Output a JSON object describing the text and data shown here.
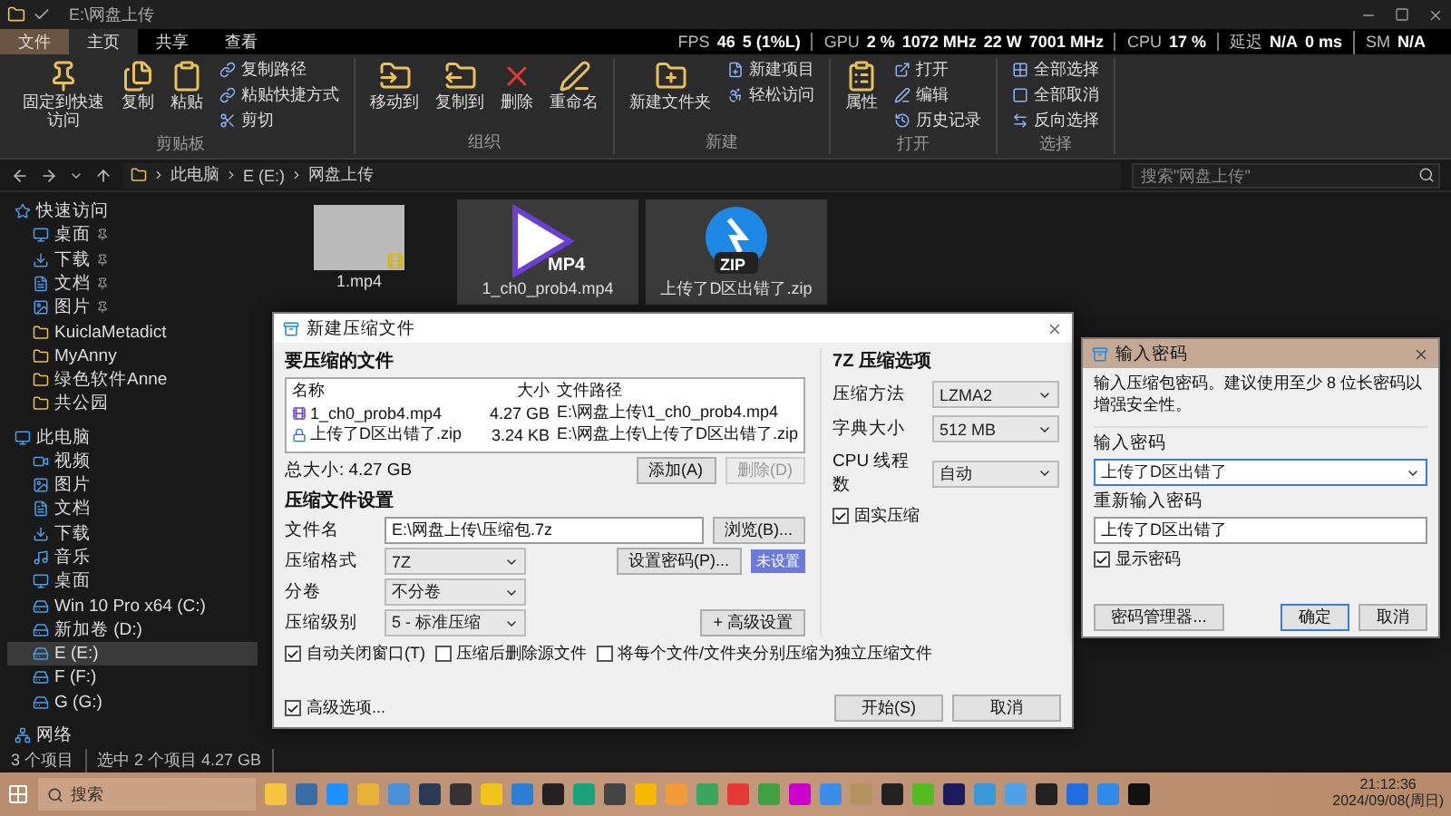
{
  "window": {
    "title": "E:\\网盘上传"
  },
  "overlay": [
    {
      "label": "FPS",
      "values": [
        "46",
        "5 (1%L)"
      ]
    },
    {
      "label": "GPU",
      "values": [
        "2 %",
        "1072 MHz",
        "22 W",
        "7001 MHz"
      ]
    },
    {
      "label": "CPU",
      "values": [
        "17 %"
      ]
    },
    {
      "label": "延迟",
      "values": [
        "N/A",
        "0 ms"
      ]
    },
    {
      "label": "SM",
      "values": [
        "N/A"
      ]
    }
  ],
  "ribbon": {
    "tabs": [
      {
        "label": "文件",
        "selected": false
      },
      {
        "label": "主页",
        "selected": true
      },
      {
        "label": "共享",
        "selected": false
      },
      {
        "label": "查看",
        "selected": false
      }
    ],
    "groups": [
      {
        "label": "剪贴板",
        "items": [
          {
            "label": "固定到快速访问",
            "kind": "large"
          },
          {
            "label": "复制",
            "kind": "large"
          },
          {
            "label": "粘贴",
            "kind": "large"
          },
          {
            "label": "复制路径",
            "kind": "small"
          },
          {
            "label": "粘贴快捷方式",
            "kind": "small"
          },
          {
            "label": "剪切",
            "kind": "small"
          }
        ]
      },
      {
        "label": "组织",
        "items": [
          {
            "label": "移动到",
            "kind": "large"
          },
          {
            "label": "复制到",
            "kind": "large"
          },
          {
            "label": "删除",
            "kind": "large"
          },
          {
            "label": "重命名",
            "kind": "large"
          }
        ]
      },
      {
        "label": "新建",
        "items": [
          {
            "label": "新建文件夹",
            "kind": "large"
          },
          {
            "label": "新建项目",
            "kind": "small"
          },
          {
            "label": "轻松访问",
            "kind": "small"
          }
        ]
      },
      {
        "label": "打开",
        "items": [
          {
            "label": "属性",
            "kind": "large"
          },
          {
            "label": "打开",
            "kind": "small"
          },
          {
            "label": "编辑",
            "kind": "small"
          },
          {
            "label": "历史记录",
            "kind": "small"
          }
        ]
      },
      {
        "label": "选择",
        "items": [
          {
            "label": "全部选择",
            "kind": "small"
          },
          {
            "label": "全部取消",
            "kind": "small"
          },
          {
            "label": "反向选择",
            "kind": "small"
          }
        ]
      }
    ]
  },
  "address": {
    "crumbs": [
      "此电脑",
      "E (E:)",
      "网盘上传"
    ],
    "search_placeholder": "搜索\"网盘上传\""
  },
  "sidebar": {
    "items": [
      {
        "label": "快速访问",
        "kind": "star",
        "selected": false,
        "children": [
          {
            "label": "桌面",
            "kind": "desktop",
            "selected": false,
            "pinned": true
          },
          {
            "label": "下载",
            "kind": "download",
            "selected": false,
            "pinned": true
          },
          {
            "label": "文档",
            "kind": "document",
            "selected": false,
            "pinned": true
          },
          {
            "label": "图片",
            "kind": "picture",
            "selected": false,
            "pinned": true
          },
          {
            "label": "KuiclaMetadict",
            "kind": "folder",
            "selected": false,
            "pinned": false
          },
          {
            "label": "MyAnny",
            "kind": "folder",
            "selected": false,
            "pinned": false
          },
          {
            "label": "绿色软件Anne",
            "kind": "folder",
            "selected": false,
            "pinned": false
          },
          {
            "label": "共公园",
            "kind": "folder",
            "selected": false,
            "pinned": false
          }
        ]
      },
      {
        "label": "此电脑",
        "kind": "pc",
        "selected": false,
        "children": [
          {
            "label": "视频",
            "kind": "video",
            "selected": false
          },
          {
            "label": "图片",
            "kind": "picture",
            "selected": false
          },
          {
            "label": "文档",
            "kind": "document",
            "selected": false
          },
          {
            "label": "下载",
            "kind": "download",
            "selected": false
          },
          {
            "label": "音乐",
            "kind": "music",
            "selected": false
          },
          {
            "label": "桌面",
            "kind": "desktop",
            "selected": false
          },
          {
            "label": "Win 10 Pro x64 (C:)",
            "kind": "drive",
            "selected": false
          },
          {
            "label": "新加卷 (D:)",
            "kind": "drive",
            "selected": false
          },
          {
            "label": "E (E:)",
            "kind": "drive",
            "selected": true
          },
          {
            "label": "F (F:)",
            "kind": "drive",
            "selected": false
          },
          {
            "label": "G (G:)",
            "kind": "drive",
            "selected": false
          }
        ]
      },
      {
        "label": "网络",
        "kind": "network",
        "selected": false
      }
    ]
  },
  "files": [
    {
      "name": "1.mp4",
      "kind": "video",
      "selected": false
    },
    {
      "name": "1_ch0_prob4.mp4",
      "kind": "mp4",
      "badge": "MP4",
      "selected": true
    },
    {
      "name": "上传了D区出错了.zip",
      "kind": "zip",
      "badge": "ZIP",
      "selected": true
    }
  ],
  "archive_dialog": {
    "title": "新建压缩文件",
    "files_header": "要压缩的文件",
    "columns": [
      "名称",
      "大小",
      "文件路径"
    ],
    "rows": [
      {
        "cells": [
          "1_ch0_prob4.mp4",
          "4.27 GB",
          "E:\\网盘上传\\1_ch0_prob4.mp4"
        ],
        "kind": "video"
      },
      {
        "cells": [
          "上传了D区出错了.zip",
          "3.24 KB",
          "E:\\网盘上传\\上传了D区出错了.zip"
        ],
        "kind": "zip"
      }
    ],
    "total": "总大小: 4.27 GB",
    "list_buttons": [
      {
        "label": "添加(A)",
        "disabled": false
      },
      {
        "label": "删除(D)",
        "disabled": true
      }
    ],
    "settings_header": "压缩文件设置",
    "fields": [
      {
        "label": "文件名",
        "kind": "input",
        "value": "E:\\网盘上传\\压缩包.7z",
        "button": "浏览(B)..."
      },
      {
        "label": "压缩格式",
        "kind": "select",
        "value": "7Z",
        "button": "设置密码(P)...",
        "tag": "未设置"
      },
      {
        "label": "分卷",
        "kind": "select",
        "value": "不分卷"
      },
      {
        "label": "压缩级别",
        "kind": "select",
        "value": "5 - 标准压缩",
        "button": "+ 高级设置"
      }
    ],
    "checks": [
      {
        "label": "自动关闭窗口(T)",
        "checked": true
      },
      {
        "label": "压缩后删除源文件",
        "checked": false
      },
      {
        "label": "将每个文件/文件夹分别压缩为独立压缩文件",
        "checked": false
      }
    ],
    "options_header": "7Z 压缩选项",
    "options": [
      {
        "label": "压缩方法",
        "value": "LZMA2"
      },
      {
        "label": "字典大小",
        "value": "512 MB"
      },
      {
        "label": "CPU 线程数",
        "value": "自动"
      }
    ],
    "solid": {
      "label": "固实压缩",
      "checked": true
    },
    "advanced": {
      "label": "高级选项...",
      "checked": true
    },
    "buttons": [
      "开始(S)",
      "取消"
    ]
  },
  "password_dialog": {
    "title": "输入密码",
    "message": "输入压缩包密码。建议使用至少 8 位长密码以增强安全性。",
    "fields": [
      {
        "label": "输入密码",
        "value": "上传了D区出错了",
        "kind": "select"
      },
      {
        "label": "重新输入密码",
        "value": "上传了D区出错了",
        "kind": "input"
      }
    ],
    "show": {
      "label": "显示密码",
      "checked": true
    },
    "buttons": [
      {
        "label": "密码管理器...",
        "kind": "wide"
      },
      {
        "label": "确定",
        "kind": "default"
      },
      {
        "label": "取消",
        "kind": "normal"
      }
    ]
  },
  "status_bar": [
    "3 个项目",
    "选中 2 个项目  4.27 GB"
  ],
  "taskbar": {
    "search": "搜索",
    "time": "21:12:36",
    "date": "2024/09/08(周日)"
  }
}
